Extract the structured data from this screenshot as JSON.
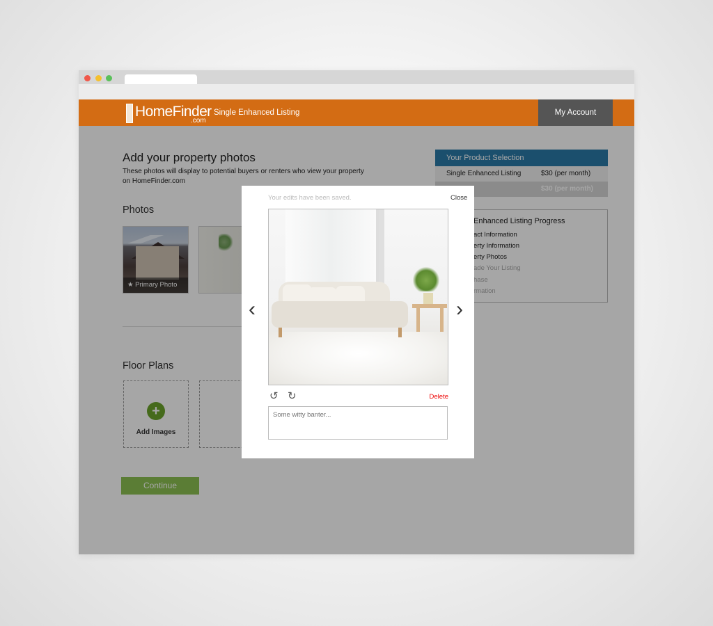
{
  "colors": {
    "brand": "#d36c14",
    "header_button": "#555555",
    "product_header": "#2a7aa8",
    "continue": "#8cc152",
    "add": "#6aa32a",
    "delete": "#e00000"
  },
  "header": {
    "logo_main": "HomeFinder",
    "logo_sub": ".com",
    "subtitle": "Single Enhanced Listing",
    "account_label": "My Account"
  },
  "main": {
    "title": "Add your property photos",
    "description": "These photos will display to potential buyers or renters who view your property on HomeFinder.com",
    "photos_heading": "Photos",
    "primary_photo_label": "Primary Photo",
    "floor_plans_heading": "Floor Plans",
    "add_images_label": "Add Images",
    "continue_label": "Continue"
  },
  "product_selection": {
    "header": "Your Product Selection",
    "items": [
      {
        "name": "Single Enhanced Listing",
        "price": "$30 (per month)"
      }
    ],
    "total_price": "$30 (per month)"
  },
  "progress": {
    "title": "Enhanced Listing Progress",
    "steps": [
      {
        "label": "act Information",
        "state": "done"
      },
      {
        "label": "erty Information",
        "state": "done"
      },
      {
        "label": "erty Photos",
        "state": "current"
      },
      {
        "label": "ade Your Listing",
        "state": "pending"
      },
      {
        "label": "hase",
        "state": "pending"
      },
      {
        "label": "rmation",
        "state": "pending"
      }
    ]
  },
  "modal": {
    "saved_text": "Your edits have been saved.",
    "close_label": "Close",
    "delete_label": "Delete",
    "caption_placeholder": "Some witty banter...",
    "icons": {
      "prev": "chevron-left-icon",
      "next": "chevron-right-icon",
      "rotate_left": "rotate-left-icon",
      "rotate_right": "rotate-right-icon"
    }
  }
}
